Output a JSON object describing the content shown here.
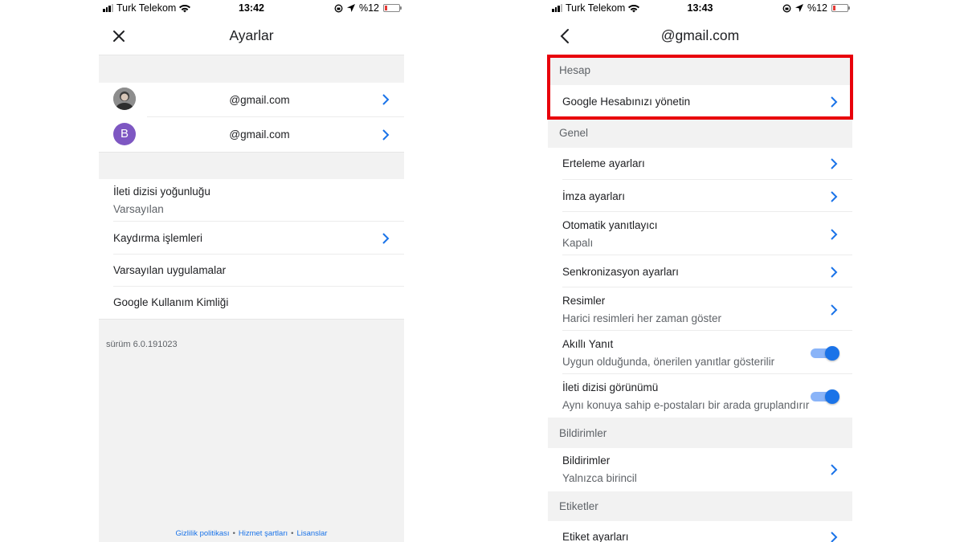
{
  "left": {
    "status": {
      "carrier": "Turk Telekom",
      "time": "13:42",
      "battery": "%12"
    },
    "title": "Ayarlar",
    "accounts": [
      {
        "email": "@gmail.com",
        "avatar": "photo"
      },
      {
        "email": "@gmail.com",
        "avatar": "letter",
        "initial": "B"
      }
    ],
    "settings": {
      "thread_density": {
        "label": "İleti dizisi yoğunluğu",
        "value": "Varsayılan"
      },
      "swipe_actions": "Kaydırma işlemleri",
      "default_apps": "Varsayılan uygulamalar",
      "usage_id": "Google Kullanım Kimliği"
    },
    "version": "sürüm 6.0.191023",
    "footer": {
      "privacy": "Gizlilik politikası",
      "terms": "Hizmet şartları",
      "licenses": "Lisanslar"
    }
  },
  "right": {
    "status": {
      "carrier": "Turk Telekom",
      "time": "13:43",
      "battery": "%12"
    },
    "title": "@gmail.com",
    "sections": {
      "account": {
        "header": "Hesap",
        "manage": "Google Hesabınızı yönetin"
      },
      "general": {
        "header": "Genel",
        "snooze": "Erteleme ayarları",
        "signature": "İmza ayarları",
        "auto_reply": {
          "label": "Otomatik yanıtlayıcı",
          "value": "Kapalı"
        },
        "sync": "Senkronizasyon ayarları",
        "images": {
          "label": "Resimler",
          "value": "Harici resimleri her zaman göster"
        },
        "smart_reply": {
          "label": "Akıllı Yanıt",
          "value": "Uygun olduğunda, önerilen yanıtlar gösterilir",
          "enabled": true
        },
        "conversation_view": {
          "label": "İleti dizisi görünümü",
          "value": "Aynı konuya sahip e-postaları bir arada gruplandırır",
          "enabled": true
        }
      },
      "notifications": {
        "header": "Bildirimler",
        "label": "Bildirimler",
        "value": "Yalnızca birincil"
      },
      "labels": {
        "header": "Etiketler",
        "label_settings": "Etiket ayarları"
      }
    }
  },
  "colors": {
    "accent": "#1a73e8",
    "highlight": "#e8000b",
    "avatar_letter": "#7e57c2"
  },
  "icons": [
    "close-icon",
    "back-arrow-icon",
    "chevron-right-icon",
    "wifi-icon",
    "location-icon",
    "lock-rotation-icon",
    "battery-icon",
    "signal-icon"
  ]
}
